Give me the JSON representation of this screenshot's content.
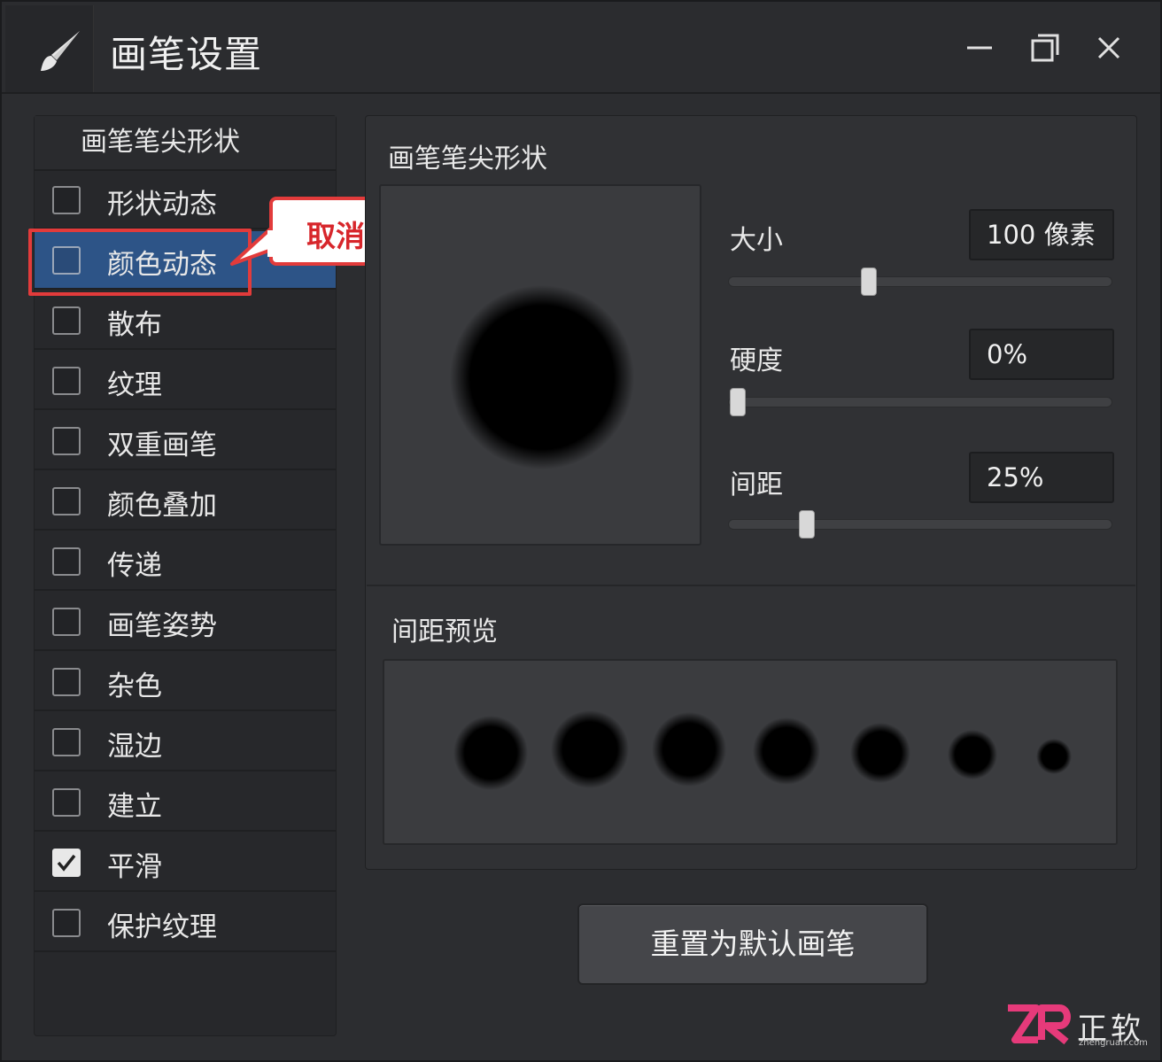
{
  "window": {
    "title": "画笔设置"
  },
  "left_panel": {
    "header": "画笔笔尖形状",
    "options": [
      {
        "label": "形状动态",
        "checked": false,
        "selected": false
      },
      {
        "label": "颜色动态",
        "checked": false,
        "selected": true
      },
      {
        "label": "散布",
        "checked": false,
        "selected": false
      },
      {
        "label": "纹理",
        "checked": false,
        "selected": false
      },
      {
        "label": "双重画笔",
        "checked": false,
        "selected": false
      },
      {
        "label": "颜色叠加",
        "checked": false,
        "selected": false
      },
      {
        "label": "传递",
        "checked": false,
        "selected": false
      },
      {
        "label": "画笔姿势",
        "checked": false,
        "selected": false
      },
      {
        "label": "杂色",
        "checked": false,
        "selected": false
      },
      {
        "label": "湿边",
        "checked": false,
        "selected": false
      },
      {
        "label": "建立",
        "checked": false,
        "selected": false
      },
      {
        "label": "平滑",
        "checked": true,
        "selected": false
      },
      {
        "label": "保护纹理",
        "checked": false,
        "selected": false
      }
    ]
  },
  "callout": {
    "text": "取消勾选颜色动态"
  },
  "tip_section": {
    "title": "画笔笔尖形状",
    "params": [
      {
        "label": "大小",
        "value": "100 像素",
        "slider_fraction": 0.36
      },
      {
        "label": "硬度",
        "value": "0%",
        "slider_fraction": 0.0
      },
      {
        "label": "间距",
        "value": "25%",
        "slider_fraction": 0.19
      }
    ]
  },
  "spacing_section": {
    "title": "间距预览"
  },
  "reset_button": {
    "label": "重置为默认画笔"
  },
  "watermark": {
    "brand": "正软",
    "sub": "zhengruan.com"
  },
  "colors": {
    "accent_selected": "#2d5487",
    "callout_red": "#e23b3b",
    "panel_bg": "#303134"
  },
  "icons": {
    "app": "paintbrush-icon",
    "minimize": "minimize-icon",
    "maximize": "maximize-icon",
    "close": "close-icon",
    "check": "checkmark-icon"
  }
}
